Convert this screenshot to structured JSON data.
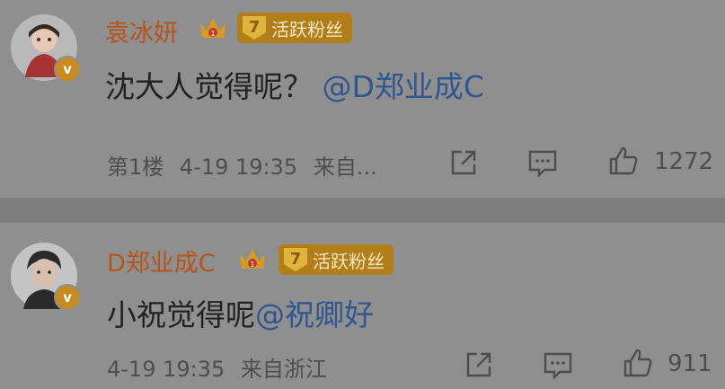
{
  "comments": [
    {
      "username": "袁冰妍",
      "level": "7",
      "badge": "活跃粉丝",
      "verified_mark": "v",
      "text": "沈大人觉得呢？",
      "mention": "@D郑业成C",
      "floor": "第1楼",
      "time": "4-19 19:35",
      "source": "来自...",
      "like_count": "1272"
    },
    {
      "username": "D郑业成C",
      "level": "7",
      "badge": "活跃粉丝",
      "verified_mark": "v",
      "text": "小祝觉得呢",
      "mention": "@祝卿好",
      "time": "4-19 19:35",
      "source": "来自浙江",
      "like_count": "911"
    }
  ],
  "colors": {
    "username": "#b8531a",
    "mention": "#2f5690",
    "badge": "#b27e17",
    "background": "#8f8f8f"
  },
  "icons": [
    "share-icon",
    "comment-icon",
    "like-icon"
  ]
}
